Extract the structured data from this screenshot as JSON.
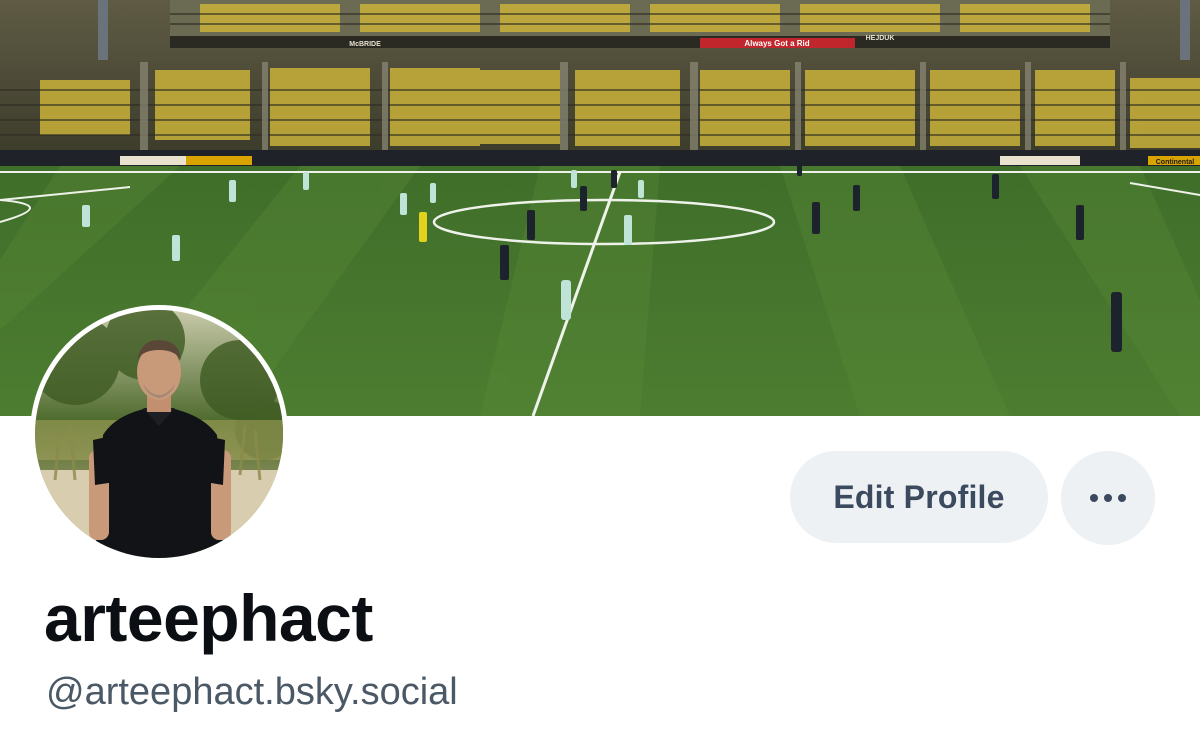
{
  "profile": {
    "display_name": "arteephact",
    "handle": "@arteephact.bsky.social",
    "banner": {
      "scene": "soccer-stadium-pitch",
      "board_text_1": "Always Got a Rid",
      "board_text_2": "Continental",
      "board_text_3": "McBRIDE",
      "board_text_4": "HEJDUK"
    },
    "avatar": {
      "scene": "man-in-black-polo-outdoors"
    }
  },
  "actions": {
    "edit_profile_label": "Edit Profile",
    "more_icon": "ellipsis-icon"
  },
  "colors": {
    "button_bg": "#eef1f4",
    "button_text": "#3b4a5e",
    "name_text": "#0b0f14",
    "handle_text": "#4b5866",
    "pitch_green": "#4a7a2c"
  }
}
